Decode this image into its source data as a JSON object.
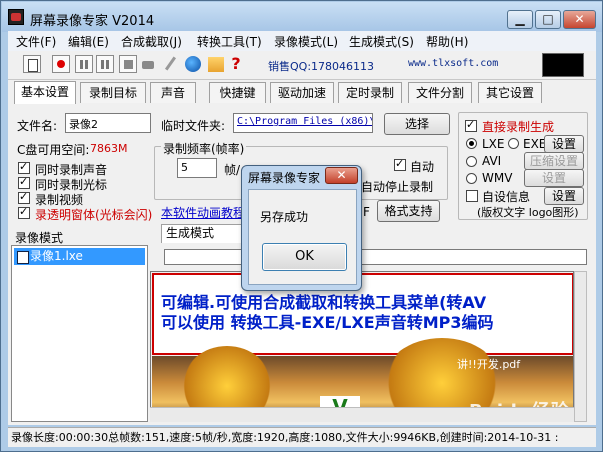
{
  "window": {
    "title": "屏幕录像专家 V2014",
    "min": "▁",
    "max": "□",
    "close": "✕"
  },
  "menu": [
    "文件(F)",
    "编辑(E)",
    "合成截取(J)",
    "转换工具(T)",
    "录像模式(L)",
    "生成模式(S)",
    "帮助(H)"
  ],
  "toolbar": {
    "qq": "销售QQ:178046113",
    "site": "www.tlxsoft.com",
    "icons": [
      "new-doc-icon",
      "record-icon",
      "pause-icon",
      "pause2-icon",
      "stop-icon",
      "camera-icon",
      "pen-icon",
      "globe-icon",
      "gift-icon",
      "help-icon"
    ],
    "help_glyph": "?"
  },
  "tabs": [
    "基本设置",
    "录制目标",
    "声音",
    "快捷键",
    "驱动加速",
    "定时录制",
    "文件分割",
    "其它设置"
  ],
  "basic": {
    "filename_label": "文件名:",
    "filename_value": "录像2",
    "tempdir_label": "临时文件夹:",
    "tempdir_value": "C:\\Program Files (x86)\\",
    "select_button": "选择",
    "disk_label": "C盘可用空间:",
    "disk_value": "7863M",
    "cb_sound": "同时录制声音",
    "cb_cursor": "同时录制光标",
    "cb_video": "录制视频",
    "cb_transparent": "录透明窗体(光标会闪)",
    "framerate_label": "录制频率(帧率)",
    "framerate_value": "5",
    "fps_unit": "帧/",
    "auto_label": "自动",
    "auto_stop_label": "自动停止录制",
    "anim_link": "本软件动画教程",
    "format_prefix": "F",
    "format_button": "格式支持",
    "direct_gen": "直接录制生成",
    "lxe": "LXE",
    "exe": "EXE",
    "avi": "AVI",
    "wmv": "WMV",
    "settings": "设置",
    "compress_settings": "压缩设置",
    "custom_info": "自设信息",
    "copyright": "(版权文字 logo图形)"
  },
  "left_panel": {
    "header": "录像模式",
    "item": "录像1.lxe"
  },
  "right_panel": {
    "header": "生成模式"
  },
  "preview": {
    "line1": "可编辑.可使用合成截取和转换工具菜单(转AV",
    "line2": "可以使用 转换工具-EXE/LXE声音转MP3编码",
    "scene_text": "讲!!开发.pdf",
    "watermark": "Baidu经验"
  },
  "status": "录像长度:00:00:30总帧数:151,速度:5帧/秒,宽度:1920,高度:1080,文件大小:9946KB,创建时间:2014-10-31 :",
  "dialog": {
    "title": "屏幕录像专家",
    "close": "✕",
    "message": "另存成功",
    "ok": "OK"
  }
}
